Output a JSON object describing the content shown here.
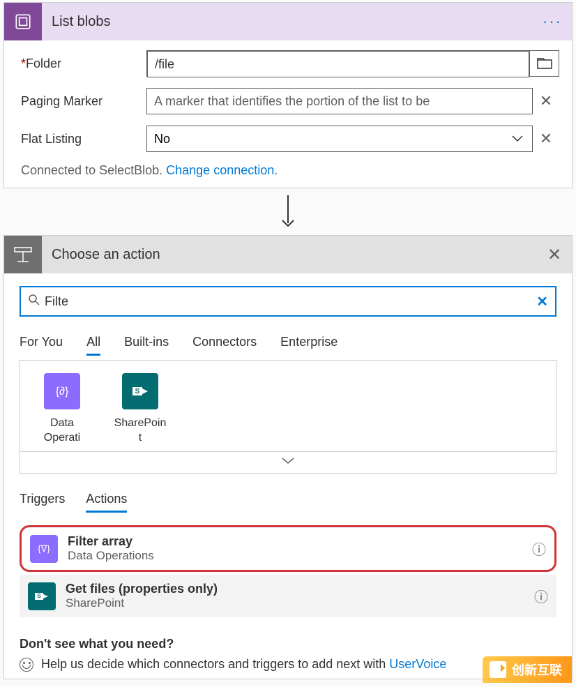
{
  "card1": {
    "title": "List blobs",
    "folder": {
      "label": "Folder",
      "required": "*",
      "value": "/file"
    },
    "paging": {
      "label": "Paging Marker",
      "placeholder": "A marker that identifies the portion of the list to be"
    },
    "flat": {
      "label": "Flat Listing",
      "value": "No"
    },
    "connected_prefix": "Connected to SelectBlob. ",
    "change_link": "Change connection."
  },
  "card2": {
    "title": "Choose an action",
    "search_value": "Filte",
    "category_tabs": {
      "t0": "For You",
      "t1": "All",
      "t2": "Built-ins",
      "t3": "Connectors",
      "t4": "Enterprise"
    },
    "connectors": {
      "c0": "Data Operati",
      "c1": "SharePoin t"
    },
    "ta_tabs": {
      "t0": "Triggers",
      "t1": "Actions"
    },
    "actions": {
      "a0": {
        "title": "Filter array",
        "sub": "Data Operations"
      },
      "a1": {
        "title": "Get files (properties only)",
        "sub": "SharePoint"
      }
    },
    "footer": {
      "q": "Don't see what you need?",
      "help_prefix": "Help us decide which connectors and triggers to add next with ",
      "uservoice": "UserVoice"
    }
  },
  "watermark": "创新互联"
}
